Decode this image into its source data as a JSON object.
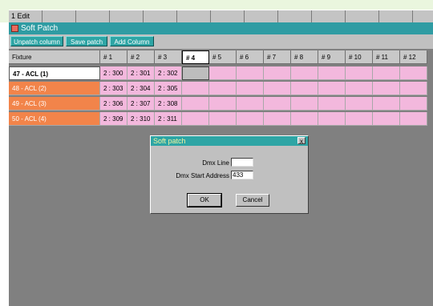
{
  "tabs": [
    "1 Edit",
    "",
    "",
    "",
    "",
    "",
    "",
    "",
    "",
    "",
    "",
    "",
    ""
  ],
  "window": {
    "title": "Soft Patch"
  },
  "toolbar": {
    "unpatch_label": "Unpatch column",
    "save_label": "Save patch",
    "add_label": "Add Column"
  },
  "grid": {
    "fixture_header": "Fixture",
    "columns": [
      "# 1",
      "# 2",
      "# 3",
      "# 4",
      "# 5",
      "# 6",
      "# 7",
      "# 8",
      "# 9",
      "# 10",
      "# 11",
      "# 12"
    ],
    "active_column": 3,
    "rows": [
      {
        "fixture": "47 - ACL (1)",
        "addresses": [
          "2 : 300",
          "2 : 301",
          "2 : 302"
        ],
        "selected": true
      },
      {
        "fixture": "48 - ACL (2)",
        "addresses": [
          "2 : 303",
          "2 : 304",
          "2 : 305"
        ]
      },
      {
        "fixture": "49 - ACL (3)",
        "addresses": [
          "2 : 306",
          "2 : 307",
          "2 : 308"
        ]
      },
      {
        "fixture": "50 - ACL (4)",
        "addresses": [
          "2 : 309",
          "2 : 310",
          "2 : 311"
        ]
      }
    ]
  },
  "dialog": {
    "title": "Soft patch",
    "close_label": "x",
    "dmx_line_label": "Dmx Line",
    "dmx_line_value": "",
    "dmx_start_label": "Dmx Start Address",
    "dmx_start_value": "433",
    "ok_label": "OK",
    "cancel_label": "Cancel"
  },
  "colors": {
    "title_teal": "#2f9ca3",
    "fixture_orange": "#f2844a",
    "patch_pink": "#f3b8dd",
    "workspace_gray": "#808080"
  }
}
